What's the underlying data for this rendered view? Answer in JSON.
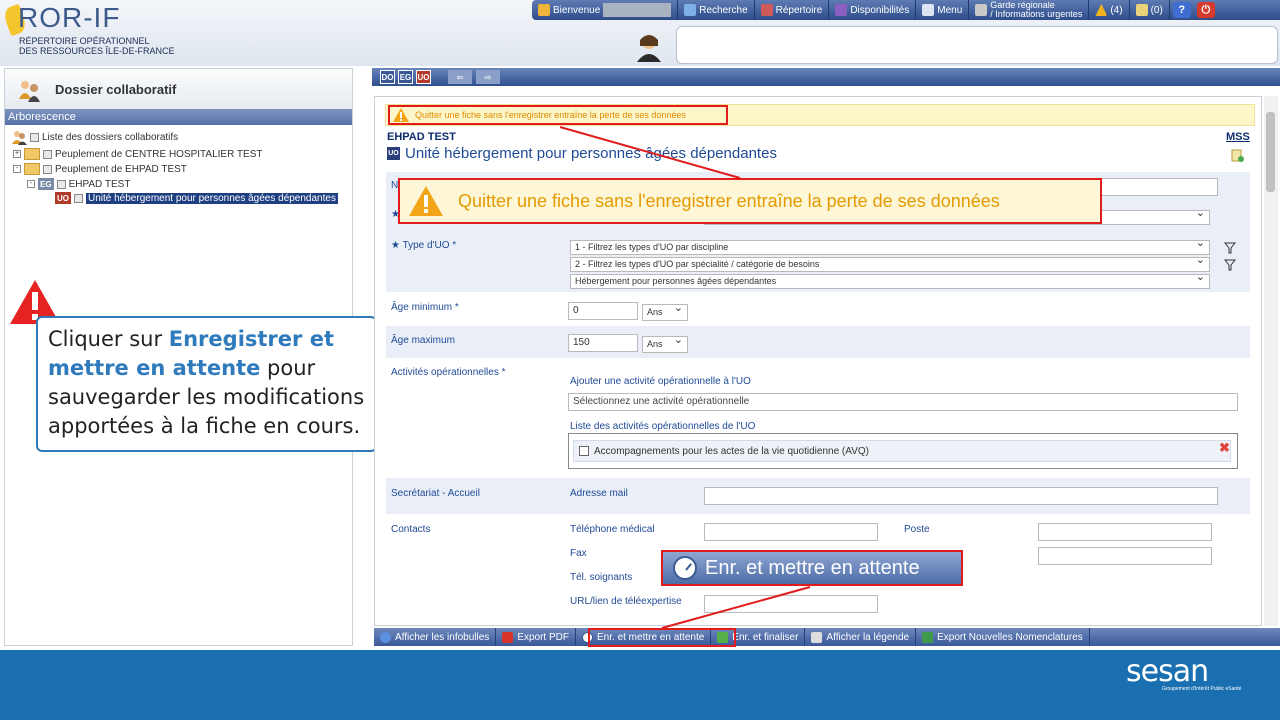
{
  "logo": {
    "title": "ROR-IF",
    "line1": "RÉPERTOIRE OPÉRATIONNEL",
    "line2": "DES RESSOURCES ÎLE-DE-FRANCE"
  },
  "topbar": {
    "welcome": "Bienvenue",
    "search": "Recherche",
    "directory": "Répertoire",
    "availability": "Disponibilités",
    "menu": "Menu",
    "garde_line1": "Garde régionale",
    "garde_line2": "/ Informations urgentes",
    "alerts_count": "(4)",
    "messages_count": "(0)",
    "help": "?"
  },
  "left_panel": {
    "title": "Dossier collaboratif",
    "section": "Arborescence",
    "tree": [
      {
        "label": "Liste des dossiers collaboratifs"
      },
      {
        "label": "Peuplement de CENTRE HOSPITALIER TEST"
      },
      {
        "label": "Peuplement de EHPAD TEST"
      },
      {
        "tag": "EG",
        "label": "EHPAD TEST"
      },
      {
        "tag": "UO",
        "label": "Unité hébergement pour personnes âgées dépendantes"
      }
    ]
  },
  "callout": {
    "prefix": "Cliquer sur ",
    "highlight": "Enregistrer et mettre en attente",
    "suffix": " pour sauvegarder les modifications apportées à la fiche en cours."
  },
  "right_toolbar": {
    "b1": "DO",
    "b2": "EG",
    "b3": "UO"
  },
  "warning_small": "Quitter une fiche sans l'enregistrer entraîne la perte de ses données",
  "warning_big": "Quitter une fiche sans l'enregistrer entraîne la perte de ses données",
  "form": {
    "org_name": "EHPAD TEST",
    "mss": "MSS",
    "uo_badge": "UO",
    "uo_title": "Unité hébergement pour personnes âgées dépendantes",
    "row1_label_initial": "N",
    "type_uo_label": "Type d'UO *",
    "type_uo_selects": [
      "1 - Filtrez les types d'UO par discipline",
      "2 - Filtrez les types d'UO par spécialité / catégorie de besoins",
      "Hébergement pour personnes âgées dépendantes"
    ],
    "age_min_label": "Âge minimum *",
    "age_min_value": "0",
    "age_max_label": "Âge maximum",
    "age_max_value": "150",
    "age_unit": "Ans",
    "activities_label": "Activités opérationnelles *",
    "add_activity_label": "Ajouter une activité opérationnelle à l'UO",
    "add_activity_placeholder": "Sélectionnez une activité opérationnelle",
    "activity_list_label": "Liste des activités opérationnelles de l'UO",
    "activity_item": "Accompagnements pour les actes de la vie quotidienne (AVQ)",
    "secretariat_label": "Secrétariat - Accueil",
    "email_label": "Adresse mail",
    "contacts_label": "Contacts",
    "tel_label": "Téléphone médical",
    "poste_label": "Poste",
    "fax_label": "Fax",
    "tel_soignants_label": "Tél. soignants",
    "url_label": "URL/lien de téléexpertise"
  },
  "enr_callout": "Enr. et mettre en attente",
  "bottom_toolbar": {
    "infobulles": "Afficher les infobulles",
    "pdf": "Export PDF",
    "enr_attente": "Enr. et mettre en attente",
    "enr_finaliser": "Enr. et finaliser",
    "legende": "Afficher la légende",
    "export_nom": "Export Nouvelles Nomenclatures"
  },
  "footer": {
    "brand": "sesan",
    "tagline": "Groupement d'Intérêt Public eSanté"
  }
}
